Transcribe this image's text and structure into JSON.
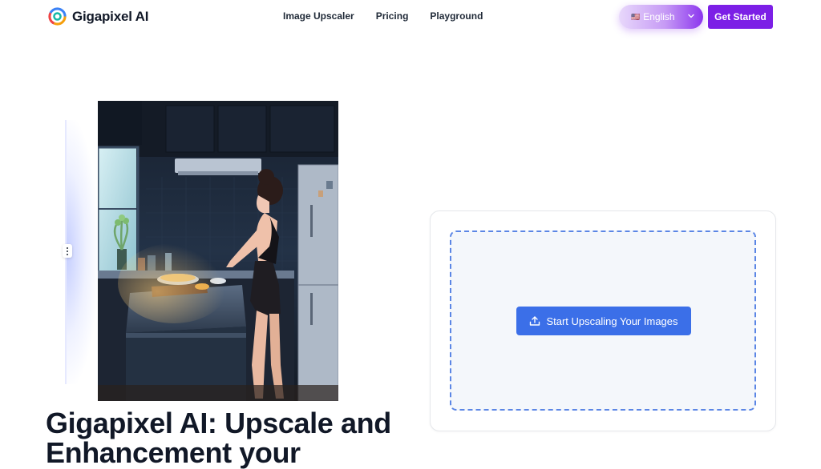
{
  "brand": {
    "name": "Gigapixel AI",
    "logo_icon": "gigapixel-logo-icon"
  },
  "nav": [
    {
      "label": "Image Upscaler"
    },
    {
      "label": "Pricing"
    },
    {
      "label": "Playground"
    }
  ],
  "language": {
    "flag": "🇺🇸",
    "label": "English",
    "icon": "chevron-down-icon"
  },
  "cta": {
    "label": "Get Started"
  },
  "hero": {
    "headline": "Gigapixel AI: Upscale and Enhancement your"
  },
  "upload": {
    "button_label": "Start Upscaling Your Images",
    "icon": "upload-icon"
  },
  "colors": {
    "primary_purple": "#7c1fe6",
    "upload_blue": "#3b6fe8",
    "dashed_border": "#5b86e5",
    "text_dark": "#111827"
  }
}
